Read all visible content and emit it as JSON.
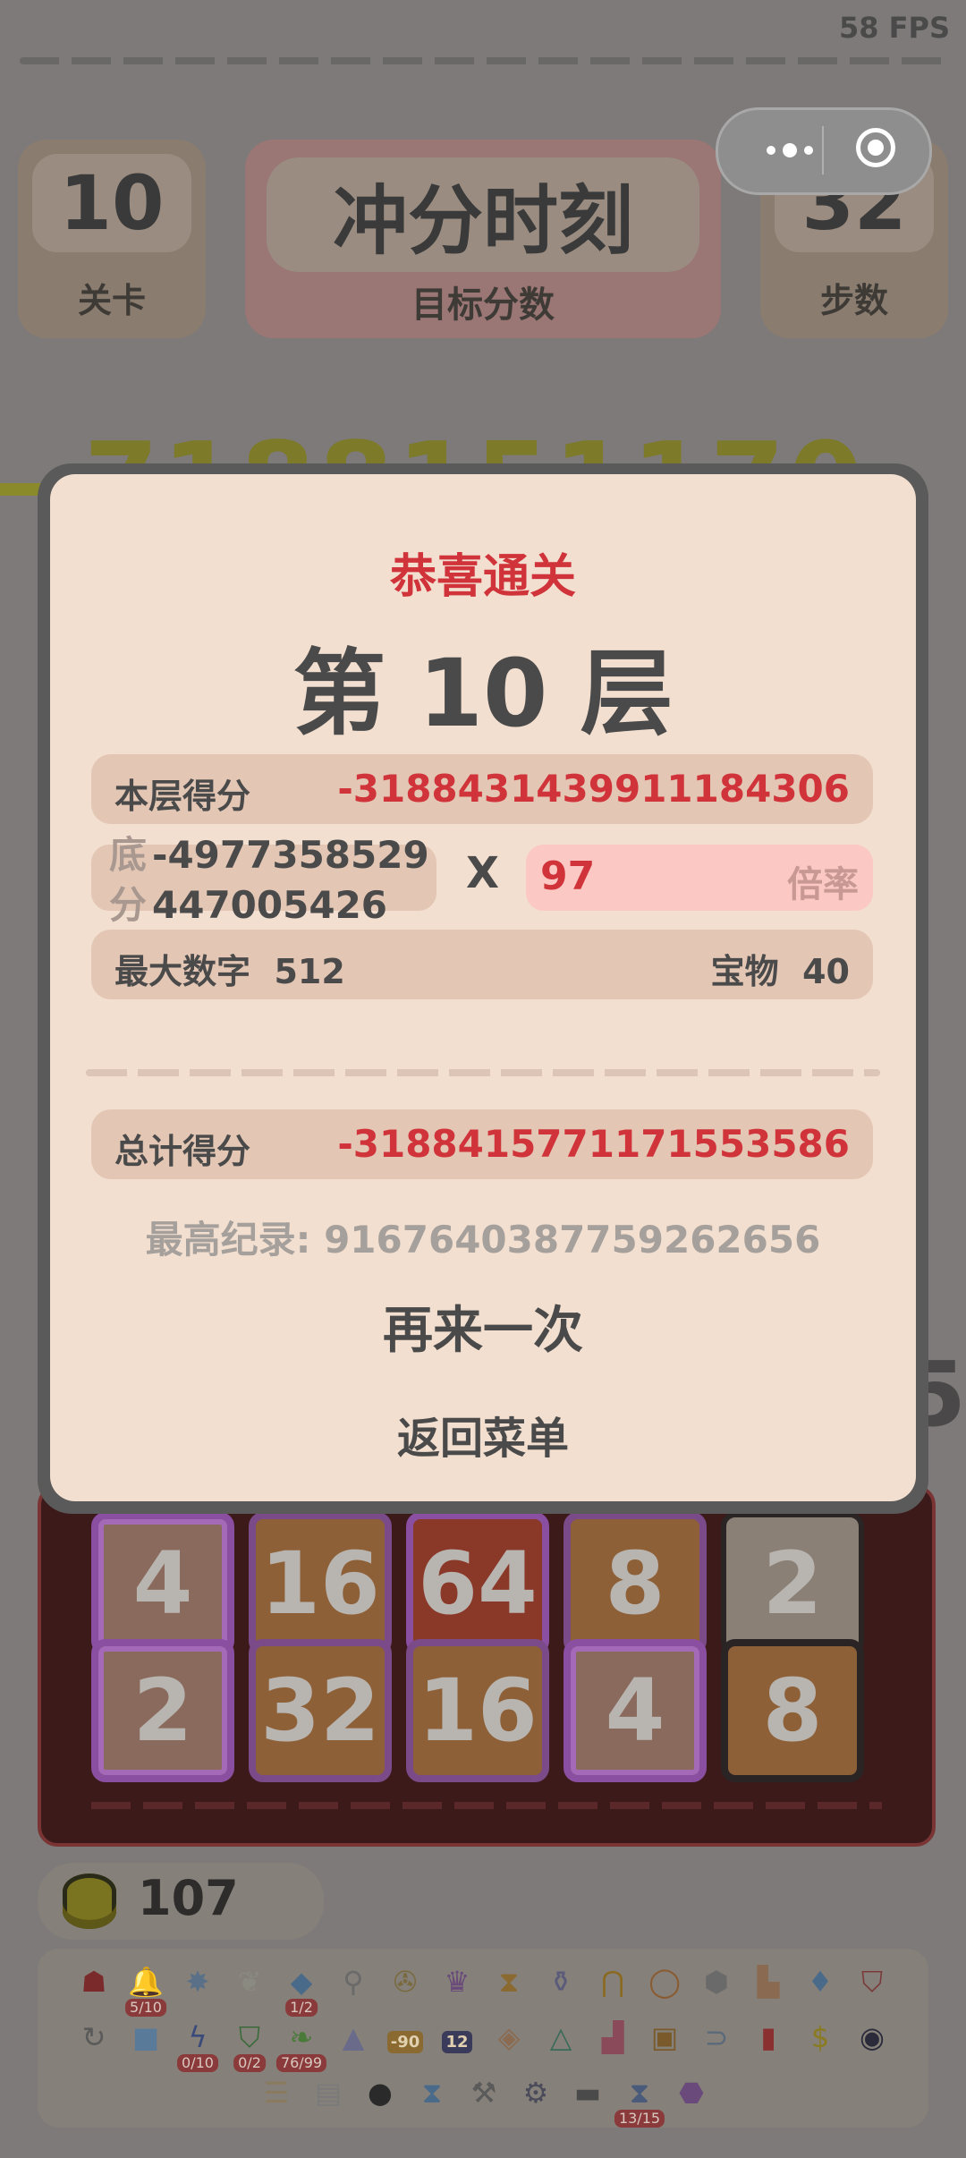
{
  "fps": "58 FPS",
  "hud": {
    "level_value": "10",
    "level_label": "关卡",
    "target_title": "冲分时刻",
    "target_label": "目标分数",
    "steps_value": "32",
    "steps_label": "步数"
  },
  "background_score": "-7188151170",
  "side_digit": "5",
  "board": {
    "rows": [
      [
        "4",
        "16",
        "64",
        "8",
        "2"
      ],
      [
        "2",
        "32",
        "16",
        "4",
        "8"
      ]
    ]
  },
  "coins": "107",
  "inventory": {
    "row1": [
      {
        "icon": "demon-mask-icon"
      },
      {
        "icon": "bell-icon",
        "badge": "5/10"
      },
      {
        "icon": "star-burst-icon"
      },
      {
        "icon": "gourd-icon"
      },
      {
        "icon": "crystal-icon",
        "badge": "1/2"
      },
      {
        "icon": "magnifier-icon"
      },
      {
        "icon": "compass-icon"
      },
      {
        "icon": "crown-icon"
      },
      {
        "icon": "hourglass-icon"
      },
      {
        "icon": "jars-icon"
      },
      {
        "icon": "magnet-icon"
      },
      {
        "icon": "ring-icon"
      },
      {
        "icon": "rock-icon"
      },
      {
        "icon": "boot-icon"
      },
      {
        "icon": "blue-crystal-icon"
      },
      {
        "icon": "shield-icon"
      }
    ],
    "row2": [
      {
        "icon": "loop-icon"
      },
      {
        "icon": "ice-cube-icon"
      },
      {
        "icon": "lightning-disk-icon",
        "badge": "0/10"
      },
      {
        "icon": "green-shield-icon",
        "badge": "0/2"
      },
      {
        "icon": "leaf-icon",
        "badge": "76/99"
      },
      {
        "icon": "pyramid-icon"
      },
      {
        "icon": "ticket-icon",
        "text": "-90"
      },
      {
        "icon": "clock-icon",
        "text": "12"
      },
      {
        "icon": "shell-icon"
      },
      {
        "icon": "triangle-icon"
      },
      {
        "icon": "sneaker-icon"
      },
      {
        "icon": "chest-icon"
      },
      {
        "icon": "pipe-icon"
      },
      {
        "icon": "book-icon"
      },
      {
        "icon": "dollar-coin-icon"
      },
      {
        "icon": "eye-orb-icon"
      }
    ],
    "row3": [
      {
        "icon": "scroll-icon"
      },
      {
        "icon": "cards-icon"
      },
      {
        "icon": "helmet-icon"
      },
      {
        "icon": "hourglass-blue-icon"
      },
      {
        "icon": "axe-icon"
      },
      {
        "icon": "gear-icon"
      },
      {
        "icon": "gun-icon"
      },
      {
        "icon": "hourglass-small-icon",
        "badge": "13/15"
      },
      {
        "icon": "purple-box-icon"
      }
    ]
  },
  "modal": {
    "congrats": "恭喜通关",
    "layer_title": "第 10 层",
    "layer_score_label": "本层得分",
    "layer_score_value": "-3188431439911184306",
    "base_label_1": "底",
    "base_label_2": "分",
    "base_value_line1": "-4977358529",
    "base_value_line2": "447005426",
    "times": "X",
    "multiplier_value": "97",
    "multiplier_label": "倍率",
    "max_number_label": "最大数字",
    "max_number_value": "512",
    "treasure_label": "宝物",
    "treasure_value": "40",
    "total_label": "总计得分",
    "total_value": "-3188415771171553586",
    "record": "最高纪录: 9167640387759262656",
    "again": "再来一次",
    "back_menu": "返回菜单"
  },
  "colors": {
    "accent_red": "#d0343a",
    "panel": "#f2dfd0",
    "overlay": "#7d7a79"
  }
}
